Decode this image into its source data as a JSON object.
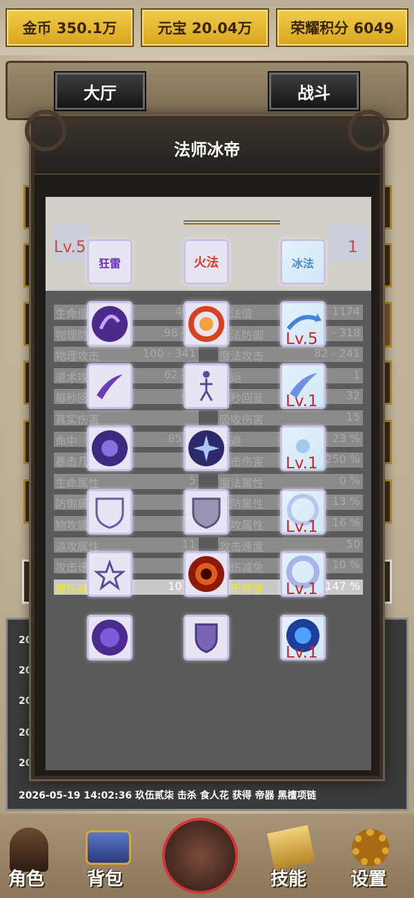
{
  "currency": {
    "gold": "金币 350.1万",
    "yuanbao": "元宝 20.04万",
    "honor": "荣耀积分 6049"
  },
  "header": {
    "hall": "大厅",
    "battle": "战斗"
  },
  "modal": {
    "title": "法师冰帝"
  },
  "stats": [
    {
      "l_label": "生命值",
      "l_value": "407",
      "r_label": "魔法值",
      "r_value": "1174"
    },
    {
      "l_label": "物理防御",
      "l_value": "98 - 2",
      "r_label": "魔法防御",
      "r_value": "- 318"
    },
    {
      "l_label": "物理攻击",
      "l_value": "100 - 341",
      "r_label": "魔法攻击",
      "r_value": "82 - 241"
    },
    {
      "l_label": "道术攻击",
      "l_value": "62 - 2",
      "r_label": "幸运",
      "r_value": "1"
    },
    {
      "l_label": "每秒回血",
      "l_value": "47",
      "r_label": "每秒回蓝",
      "r_value": "32"
    },
    {
      "l_label": "真实伤害",
      "l_value": "",
      "r_label": "吸收伤害",
      "r_value": "15"
    },
    {
      "l_label": "命中",
      "l_value": "85 %",
      "r_label": "闪避",
      "r_value": "23 %"
    },
    {
      "l_label": "暴击几率",
      "l_value": "9",
      "r_label": "暴击伤害",
      "r_value": "250 %"
    },
    {
      "l_label": "生命属性",
      "l_value": "5",
      "r_label": "魔法属性",
      "r_value": "0 %"
    },
    {
      "l_label": "防御属性",
      "l_value": "4",
      "r_label": "魔防属性",
      "r_value": "13 %"
    },
    {
      "l_label": "物攻属性",
      "l_value": "27",
      "r_label": "魔攻属性",
      "r_value": "16 %"
    },
    {
      "l_label": "道攻属性",
      "l_value": "11",
      "r_label": "攻击速度",
      "r_value": "50"
    },
    {
      "l_label": "攻击速度",
      "l_value": "9",
      "r_label": "物伤减免",
      "r_value": "10 %"
    },
    {
      "l_label": "魔伤减免",
      "l_value": "10 %",
      "r_label": "金币掉落",
      "r_value": "147 %"
    }
  ],
  "skills": {
    "tabs": [
      "狂雷",
      "火法",
      "冰法"
    ],
    "levels": {
      "r1": "Lv.5",
      "r2": "Lv.1",
      "r3": "Lv.1",
      "r4": "Lv.1",
      "r5": "Lv.1",
      "r6": "Lv.1"
    },
    "top_hint_levels": [
      "Lv.5",
      "1",
      "Lv",
      "Lv",
      "1"
    ]
  },
  "log": [
    "202",
    "202",
    "202",
    "202",
    "202",
    "2026-05-19 14:02:36 玖伍贰柒 击杀 食人花 获得 帝器 黑檀项链"
  ],
  "nav": {
    "role": "角色",
    "bag": "背包",
    "skill": "技能",
    "settings": "设置"
  },
  "colors": {
    "gold_button": "#e4b534",
    "panel": "#1e1b18",
    "level_text": "#d21f1f",
    "highlight_stat": "#f2e52c"
  }
}
